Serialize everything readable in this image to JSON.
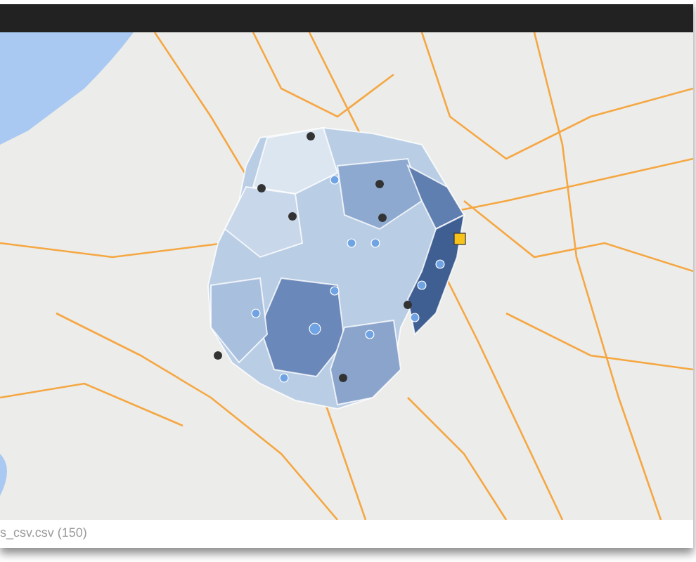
{
  "status_bar": {
    "text": "s_csv.csv (150)"
  }
}
